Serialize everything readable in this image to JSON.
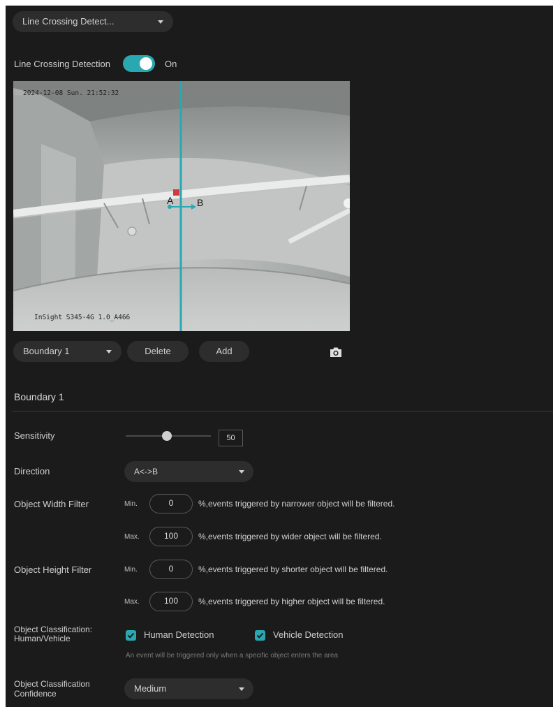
{
  "detection_select": {
    "value": "Line Crossing Detect..."
  },
  "toggle_row": {
    "label": "Line Crossing Detection",
    "state_text": "On",
    "enabled": true
  },
  "video": {
    "timestamp": "2024-12-08 Sun. 21:52:32",
    "camera_name": "InSight S345-4G 1.0_A466",
    "marker_a": "A",
    "marker_b": "B",
    "accent_color": "#2aa8b2"
  },
  "boundary_controls": {
    "select_value": "Boundary 1",
    "delete_label": "Delete",
    "add_label": "Add",
    "snapshot_icon": "camera-icon"
  },
  "section_title": "Boundary 1",
  "sensitivity": {
    "label": "Sensitivity",
    "value": "50",
    "level_percent": 50
  },
  "direction": {
    "label": "Direction",
    "value": "A<->B"
  },
  "width_filter": {
    "label": "Object Width Filter",
    "min_label": "Min.",
    "min_value": "0",
    "min_hint": "%,events triggered by narrower object will be filtered.",
    "max_label": "Max.",
    "max_value": "100",
    "max_hint": "%,events triggered by wider object will be filtered."
  },
  "height_filter": {
    "label": "Object Height Filter",
    "min_label": "Min.",
    "min_value": "0",
    "min_hint": "%,events triggered by shorter object will be filtered.",
    "max_label": "Max.",
    "max_value": "100",
    "max_hint": "%,events triggered by higher object will be filtered."
  },
  "classification": {
    "label_line1": "Object Classification:",
    "label_line2": "Human/Vehicle",
    "human_label": "Human Detection",
    "human_checked": true,
    "vehicle_label": "Vehicle Detection",
    "vehicle_checked": true,
    "note": "An event will be triggered only when a specific object enters the area"
  },
  "confidence": {
    "label_line1": "Object Classification",
    "label_line2": "Confidence",
    "value": "Medium"
  }
}
